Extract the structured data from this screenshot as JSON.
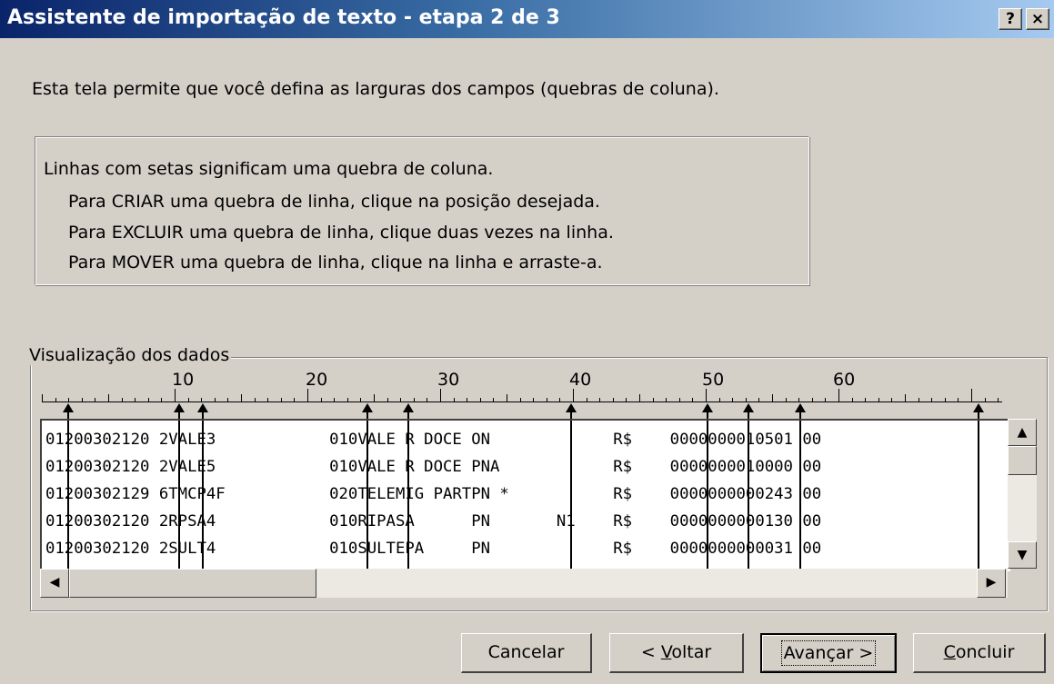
{
  "window": {
    "title": "Assistente de importação de texto - etapa 2 de 3",
    "help_label": "?",
    "close_label": "×"
  },
  "intro": "Esta tela permite que você defina as larguras dos campos (quebras de coluna).",
  "info": {
    "line1": "Linhas com setas significam uma quebra de coluna.",
    "line2": "Para CRIAR uma quebra de linha, clique na posição desejada.",
    "line3": "Para EXCLUIR uma quebra de linha, clique duas vezes na linha.",
    "line4": "Para MOVER uma quebra de linha, clique na linha e arraste-a."
  },
  "preview": {
    "label": "Visualização dos dados",
    "ruler_numbers": [
      "10",
      "20",
      "30",
      "40",
      "50",
      "60"
    ],
    "rows": [
      "01200302120 2VALE3            010VALE R DOCE ON             R$    0000000010501 00",
      "01200302120 2VALE5            010VALE R DOCE PNA            R$    0000000010000 00",
      "01200302129 6TMCP4F           020TELEMIG PARTPN *           R$    0000000000243 00",
      "01200302120 2RPSA4            010RIPASA      PN       N1    R$    0000000000130 00",
      "01200302120 2SULT4            010SULTEPA     PN             R$    0000000000031 00"
    ]
  },
  "buttons": {
    "cancel": "Cancelar",
    "back_prefix": "< ",
    "back_hot": "V",
    "back_rest": "oltar",
    "next": "Avançar >",
    "finish_hot": "C",
    "finish_rest": "oncluir"
  },
  "icons": {
    "up": "▲",
    "down": "▼",
    "left": "◀",
    "right": "▶"
  }
}
